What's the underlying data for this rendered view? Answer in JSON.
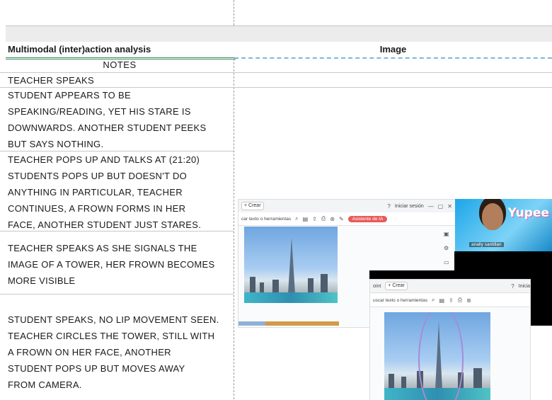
{
  "header": {
    "left_title": "Multimodal (inter)action analysis",
    "right_title": "Image",
    "notes_label": "NOTES"
  },
  "rows": [
    "TEACHER SPEAKS",
    "STUDENT APPEARS TO BE\nSPEAKING/READING, YET HIS STARE IS\nDOWNWARDS. ANOTHER STUDENT PEEKS\nBUT SAYS NOTHING.",
    "TEACHER POPS UP AND TALKS AT (21:20)\nSTUDENTS POPS UP BUT DOESN'T DO\nANYTHING IN PARTICULAR, TEACHER\nCONTINUES, A FROWN FORMS IN HER\nFACE, ANOTHER STUDENT JUST STARES.",
    "TEACHER SPEAKS AS SHE SIGNALS THE\nIMAGE OF A TOWER, HER FROWN BECOMES\nMORE VISIBLE",
    "STUDENT SPEAKS, NO LIP MOVEMENT SEEN.\nTEACHER CIRCLES THE TOWER, STILL WITH\nA FROWN ON HER FACE, ANOTHER\nSTUDENT POPS UP BUT MOVES AWAY\nFROM CAMERA."
  ],
  "screenshot": {
    "top_toolbar": {
      "create_label": "+ Crear",
      "session_label": "Iniciar sesión",
      "search_label": "car texto o herramientas",
      "ai_label": "Asistente de IA"
    },
    "bottom_toolbar": {
      "prefix_label": "oint",
      "create_label": "+ Crear",
      "search_label": "uscar texto o herramientas",
      "session_label": "Inicia"
    },
    "video": {
      "brand": "Yupee",
      "participant_name": "anally santillan"
    }
  }
}
